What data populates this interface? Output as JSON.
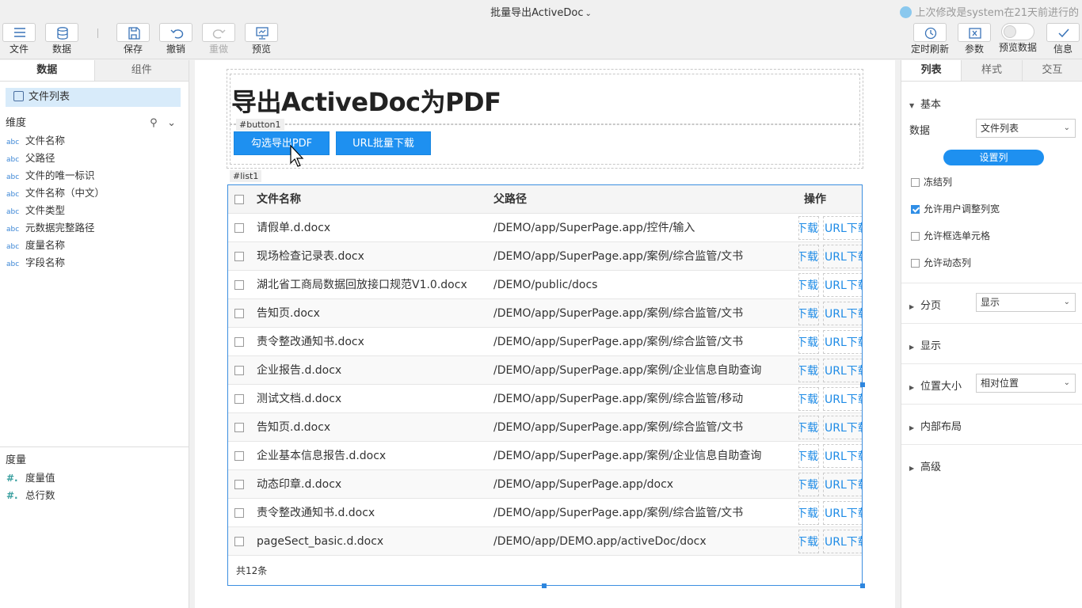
{
  "topbar": {
    "title": "批量导出ActiveDoc",
    "last_modified": "上次修改是system在21天前进行的",
    "buttons": {
      "file": "文件",
      "data": "数据",
      "save": "保存",
      "undo": "撤销",
      "redo": "重做",
      "preview": "预览",
      "refresh": "定时刷新",
      "params": "参数",
      "preview_data": "预览数据",
      "info": "信息"
    }
  },
  "left_panel": {
    "tabs": [
      "数据",
      "组件"
    ],
    "dataset": "文件列表",
    "dimensions_title": "维度",
    "dimensions": [
      {
        "type": "abc",
        "name": "文件名称"
      },
      {
        "type": "abc",
        "name": "父路径"
      },
      {
        "type": "abc",
        "name": "文件的唯一标识"
      },
      {
        "type": "abc",
        "name": "文件名称（中文）"
      },
      {
        "type": "abc",
        "name": "文件类型"
      },
      {
        "type": "abc",
        "name": "元数据完整路径"
      },
      {
        "type": "abc",
        "name": "度量名称"
      },
      {
        "type": "abc",
        "name": "字段名称"
      }
    ],
    "measures_title": "度量",
    "measures": [
      {
        "type": "#.",
        "name": "度量值"
      },
      {
        "type": "#.",
        "name": "总行数"
      }
    ]
  },
  "canvas": {
    "heading": "导出ActiveDoc为PDF",
    "button_tag": "#button1",
    "button_export": "勾选导出PDF",
    "button_url": "URL批量下载",
    "list_tag": "#list1",
    "list": {
      "columns": [
        "文件名称",
        "父路径",
        "操作"
      ],
      "rows": [
        {
          "name": "请假单.d.docx",
          "path": "/DEMO/app/SuperPage.app/控件/输入"
        },
        {
          "name": "现场检查记录表.docx",
          "path": "/DEMO/app/SuperPage.app/案例/综合监管/文书"
        },
        {
          "name": "湖北省工商局数据回放接口规范V1.0.docx",
          "path": "/DEMO/public/docs"
        },
        {
          "name": "告知页.docx",
          "path": "/DEMO/app/SuperPage.app/案例/综合监管/文书"
        },
        {
          "name": "责令整改通知书.docx",
          "path": "/DEMO/app/SuperPage.app/案例/综合监管/文书"
        },
        {
          "name": "企业报告.d.docx",
          "path": "/DEMO/app/SuperPage.app/案例/企业信息自助查询"
        },
        {
          "name": "测试文档.d.docx",
          "path": "/DEMO/app/SuperPage.app/案例/综合监管/移动"
        },
        {
          "name": "告知页.d.docx",
          "path": "/DEMO/app/SuperPage.app/案例/综合监管/文书"
        },
        {
          "name": "企业基本信息报告.d.docx",
          "path": "/DEMO/app/SuperPage.app/案例/企业信息自助查询"
        },
        {
          "name": "动态印章.d.docx",
          "path": "/DEMO/app/SuperPage.app/docx"
        },
        {
          "name": "责令整改通知书.d.docx",
          "path": "/DEMO/app/SuperPage.app/案例/综合监管/文书"
        },
        {
          "name": "pageSect_basic.d.docx",
          "path": "/DEMO/app/DEMO.app/activeDoc/docx"
        }
      ],
      "op_download": "下载",
      "op_url": "URL下载",
      "footer": "共12条"
    }
  },
  "right_panel": {
    "tabs": [
      "列表",
      "样式",
      "交互"
    ],
    "basic_title": "基本",
    "data_label": "数据",
    "data_value": "文件列表",
    "set_columns": "设置列",
    "checks": [
      {
        "label": "冻结列",
        "checked": false
      },
      {
        "label": "允许用户调整列宽",
        "checked": true
      },
      {
        "label": "允许框选单元格",
        "checked": false
      },
      {
        "label": "允许动态列",
        "checked": false
      }
    ],
    "paging_title": "分页",
    "paging_value": "显示",
    "display_title": "显示",
    "position_title": "位置大小",
    "position_value": "相对位置",
    "layout_title": "内部布局",
    "advanced_title": "高级"
  },
  "colors": {
    "accent": "#1e90f0",
    "selection_border": "#3c8ee0"
  }
}
